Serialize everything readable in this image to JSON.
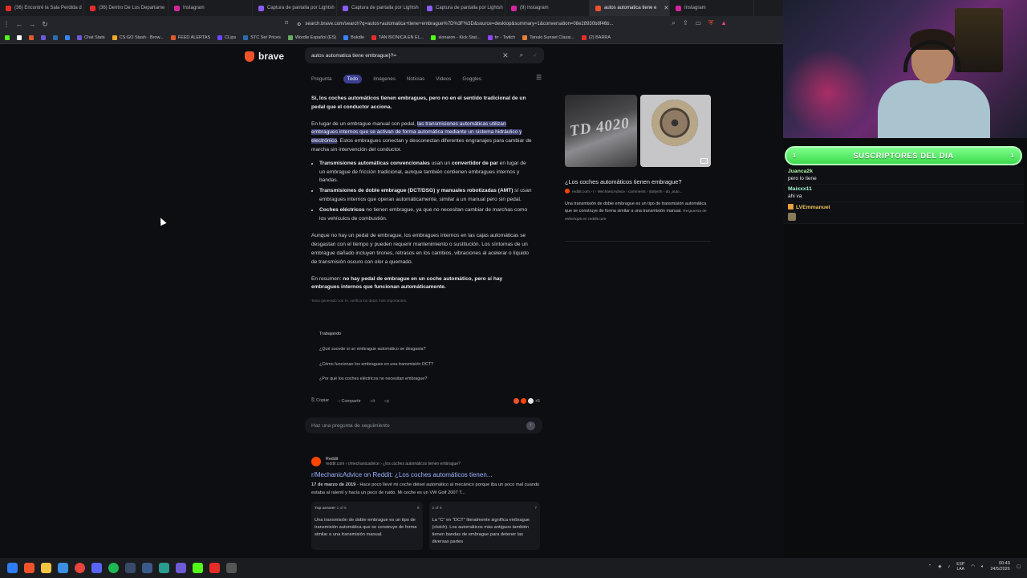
{
  "tabs": [
    {
      "label": "(36) Encontré la Sala Perdida d",
      "color": "#e52d27"
    },
    {
      "label": "(36) Dentro De Los Departame",
      "color": "#e52d27"
    },
    {
      "label": "Instagram",
      "color": "#d6249f"
    },
    {
      "label": "Captura de pantalla por Lightsh",
      "color": "#8b5cf6"
    },
    {
      "label": "Captura de pantalla por Lightsh",
      "color": "#8b5cf6"
    },
    {
      "label": "Captura de pantalla por Lightsh",
      "color": "#8b5cf6"
    },
    {
      "label": "(9) Instagram",
      "color": "#d6249f"
    },
    {
      "label": "autos automatica tiene e",
      "color": "#f0522b",
      "active": true
    },
    {
      "label": "Instagram",
      "color": "#d6249f"
    }
  ],
  "address": {
    "url": "search.brave.com/search?q=autos+automatica+tiene+embrague%7D%3F%3D&source=desktop&summary=1&conversation=08e28930b8f46b..."
  },
  "bookmarks": [
    {
      "label": "Chat Stats",
      "color": "#6b5bd6"
    },
    {
      "label": "CS:GO Stash - Brow...",
      "color": "#f0a82c"
    },
    {
      "label": "FEED ALERTAS",
      "color": "#e05a2d"
    },
    {
      "label": "CLips",
      "color": "#6c47ff"
    },
    {
      "label": "STC Set Prices",
      "color": "#2b6cb0"
    },
    {
      "label": "Wordle Español (ES)",
      "color": "#6aaa64"
    },
    {
      "label": "Bokdle",
      "color": "#3b82f6"
    },
    {
      "label": "TAN BIONICA EN EL...",
      "color": "#e52d27"
    },
    {
      "label": "sionaron - Kick Stat...",
      "color": "#53fc18"
    },
    {
      "label": "trr - Twitch",
      "color": "#9146ff"
    },
    {
      "label": "Tanuki Sunset Classi...",
      "color": "#e0813a"
    },
    {
      "label": "(2) BARRA",
      "color": "#e52d27"
    }
  ],
  "search": {
    "brand": "brave",
    "query": "autos automatica tiene embrague}?=",
    "tabs": [
      "Pregunta",
      "Todo",
      "Imágenes",
      "Noticias",
      "Videos",
      "Goggles"
    ],
    "active_tab": "Todo"
  },
  "answer": {
    "p1": "Sí, los coches automáticos tienen embragues, pero no en el sentido tradicional de un pedal que el conductor acciona.",
    "p2_pre": "En lugar de un embrague manual con pedal, ",
    "p2_hl": "las transmisiones automáticas utilizan embragues internos que se activan de forma automática mediante un sistema hidráulico y electrónico",
    "p2_post": ". Estos embragues conectan y desconectan diferentes engranajes para cambiar de marcha sin intervención del conductor.",
    "bullets": [
      {
        "bold": "Transmisiones automáticas convencionales",
        "mid": " usan un ",
        "bold2": "convertidor de par",
        "rest": " en lugar de un embrague de fricción tradicional, aunque también contienen embragues internos y bandas."
      },
      {
        "bold": "Transmisiones de doble embrague (DCT/DSG) y manuales robotizadas (AMT)",
        "mid": " sí usan embragues internos que operan automáticamente, similar a un manual pero sin pedal.",
        "bold2": "",
        "rest": ""
      },
      {
        "bold": "Coches eléctricos",
        "mid": " no tienen embrague, ya que no necesitan cambiar de marchas como los vehículos de combustión.",
        "bold2": "",
        "rest": ""
      }
    ],
    "p3": "Aunque no hay un pedal de embrague, los embragues internos en las cajas automáticas se desgastan con el tiempo y pueden requerir mantenimiento o sustitución. Los síntomas de un embrague dañado incluyen tirones, retrasos en los cambios, vibraciones al acelerar o líquido de transmisión oscuro con olor a quemado.",
    "p4_pre": "En resumen: ",
    "p4_bold": "no hay pedal de embrague en un coche automático, pero sí hay embragues internos que funcionan automáticamente.",
    "disclaimer": "Texto generado con IA, verifica los datos más importantes."
  },
  "related": {
    "title": "Trabajando",
    "questions": [
      "¿Qué sucede si un embrague automático se desgasta?",
      "¿Cómo funcionan los embragues en una transmisión DCT?",
      "¿Por qué los coches eléctricos no necesitan embrague?"
    ]
  },
  "actions": {
    "copy": "Copiar",
    "share": "Compartir",
    "more": "+5"
  },
  "followup": {
    "placeholder": "Haz una pregunta de seguimiento"
  },
  "result": {
    "site": "Reddit",
    "breadcrumb": "reddit.com › r/mechanicadvice › ¿los coches automáticos tienen embrague?",
    "title": "r/MechanicAdvice on Reddit: ¿Los coches automáticos tienen...",
    "date": "17 de marzo de 2019",
    "snippet": " - Hace poco llevé mi coche diésel automático al mecánico porque iba un poco mal cuando estaba al ralentí y hacía un poco de ruido. Mi coche es un VW Golf 2007 T...",
    "cards": [
      {
        "head": "Top answer",
        "count": "1 of 5",
        "num": "8",
        "text": "Una transmisión de doble embrague es un tipo de transmisión automática que se construye de forma similar a una transmisión manual."
      },
      {
        "head": "",
        "count": "2 of 5",
        "num": "7",
        "text": "La \"C\" en \"DCT\" literalmente significa embrague (clutch). Los automáticos más antiguos también tienen bandas de embrague para detener las diversas partes"
      }
    ]
  },
  "sidebar": {
    "image1_text": "TD 4020",
    "title": "¿Los coches automáticos tienen embrague?",
    "source": "reddit.com › r › MechanicAdvice › comments › do8ymh › do_auto...",
    "desc": "Una transmisión de doble embrague es un tipo de transmisión automática que se construye de forma similar a una transmisión manual.",
    "desc_meta": "Respuesta de rebishop6 en reddit.com"
  },
  "stream": {
    "banner": "SUSCRIPTORES DEL DIA",
    "banner_left": "1",
    "banner_right": "1",
    "chat": [
      {
        "user": "Juanca2k",
        "text": "pero lo tiene",
        "color": "#b0f7a6"
      },
      {
        "user": "Maixxx11",
        "text": "ahi va",
        "color": "#9ff4d1"
      },
      {
        "user": "LVEmmanuel",
        "text": "",
        "color": "#f3c25a",
        "crown": true
      }
    ]
  },
  "taskbar": {
    "lang1": "ESP",
    "lang2": "LAA",
    "time": "00:49",
    "date": "24/5/2026"
  }
}
